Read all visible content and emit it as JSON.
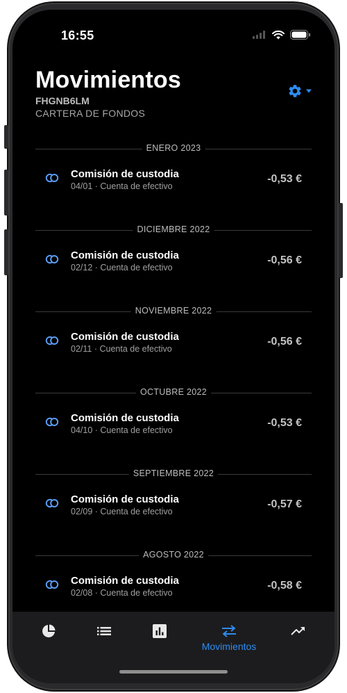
{
  "status": {
    "time": "16:55"
  },
  "header": {
    "title": "Movimientos",
    "code": "FHGNB6LM",
    "subtitle": "CARTERA DE FONDOS",
    "settings_icon": "gear-icon"
  },
  "colors": {
    "accent": "#2e8cf0",
    "background": "#000000",
    "tabbar": "#1c1c1e"
  },
  "months": [
    {
      "label": "ENERO 2023",
      "item": {
        "title": "Comisión de custodia",
        "meta": "04/01 · Cuenta de efectivo",
        "amount": "-0,53 €"
      }
    },
    {
      "label": "DICIEMBRE 2022",
      "item": {
        "title": "Comisión de custodia",
        "meta": "02/12 · Cuenta de efectivo",
        "amount": "-0,56 €"
      }
    },
    {
      "label": "NOVIEMBRE 2022",
      "item": {
        "title": "Comisión de custodia",
        "meta": "02/11 · Cuenta de efectivo",
        "amount": "-0,56 €"
      }
    },
    {
      "label": "OCTUBRE 2022",
      "item": {
        "title": "Comisión de custodia",
        "meta": "04/10 · Cuenta de efectivo",
        "amount": "-0,53 €"
      }
    },
    {
      "label": "SEPTIEMBRE 2022",
      "item": {
        "title": "Comisión de custodia",
        "meta": "02/09 · Cuenta de efectivo",
        "amount": "-0,57 €"
      }
    },
    {
      "label": "AGOSTO 2022",
      "item": {
        "title": "Comisión de custodia",
        "meta": "02/08 · Cuenta de efectivo",
        "amount": "-0,58 €"
      }
    }
  ],
  "tabbar": {
    "tabs": [
      {
        "icon": "pie-chart-icon",
        "label": ""
      },
      {
        "icon": "list-icon",
        "label": ""
      },
      {
        "icon": "bar-chart-icon",
        "label": ""
      },
      {
        "icon": "transfer-arrows-icon",
        "label": "Movimientos",
        "active": true
      },
      {
        "icon": "trending-up-icon",
        "label": ""
      }
    ]
  }
}
